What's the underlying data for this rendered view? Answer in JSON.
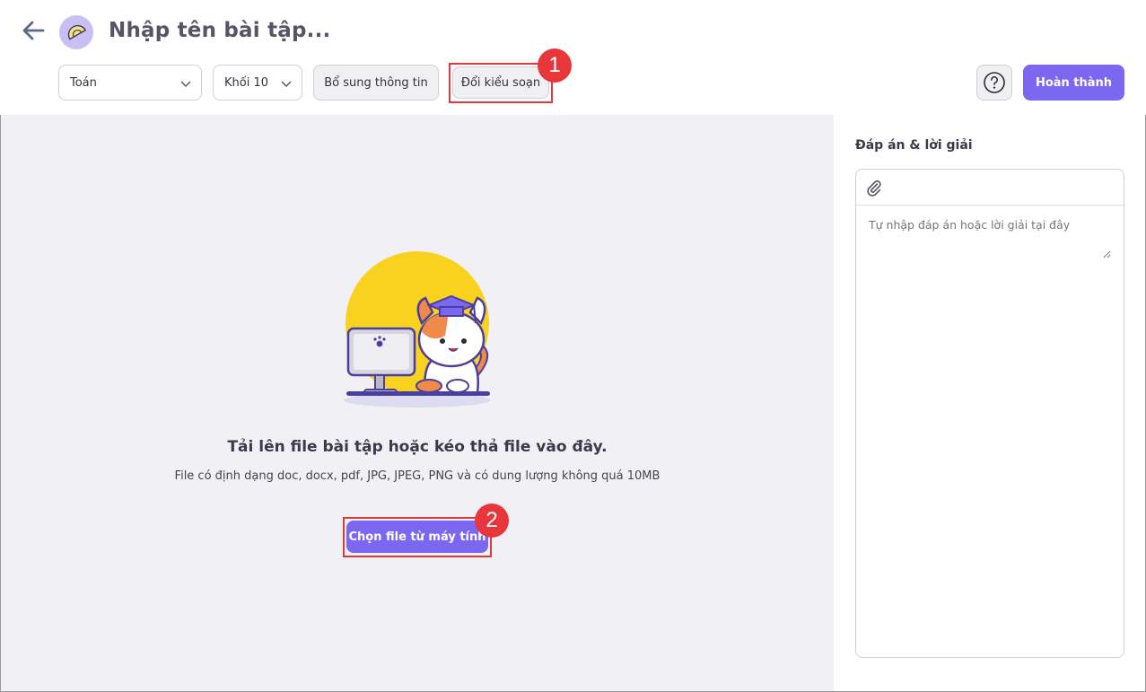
{
  "header": {
    "title": "Nhập tên bài tập...",
    "back_icon": "arrow-left-icon",
    "logo_icon": "protractor-icon",
    "subject_select": {
      "value": "Toán"
    },
    "grade_select": {
      "value": "Khối 10"
    },
    "add_info_label": "Bổ sung thông tin",
    "switch_mode_label": "Đổi kiểu soạn",
    "help_icon": "question-circle-icon",
    "finish_label": "Hoàn thành"
  },
  "annotations": {
    "badge_1": "1",
    "badge_2": "2"
  },
  "upload": {
    "illustration": "cat-at-computer-illustration",
    "title": "Tải lên file bài tập hoặc kéo thả file vào đây.",
    "subtitle": "File có định dạng doc, docx, pdf, JPG, JPEG, PNG và có dung lượng không quá 10MB",
    "choose_label": "Chọn file từ máy tính"
  },
  "answer_panel": {
    "label": "Đáp án & lời giải",
    "attach_icon": "paperclip-icon",
    "placeholder": "Tự nhập đáp án hoặc lời giải tại đây"
  },
  "colors": {
    "accent": "#7b67f0",
    "highlight": "#e2383b",
    "main_bg": "#f1f1f5",
    "illustration_sun": "#f9d11f"
  }
}
